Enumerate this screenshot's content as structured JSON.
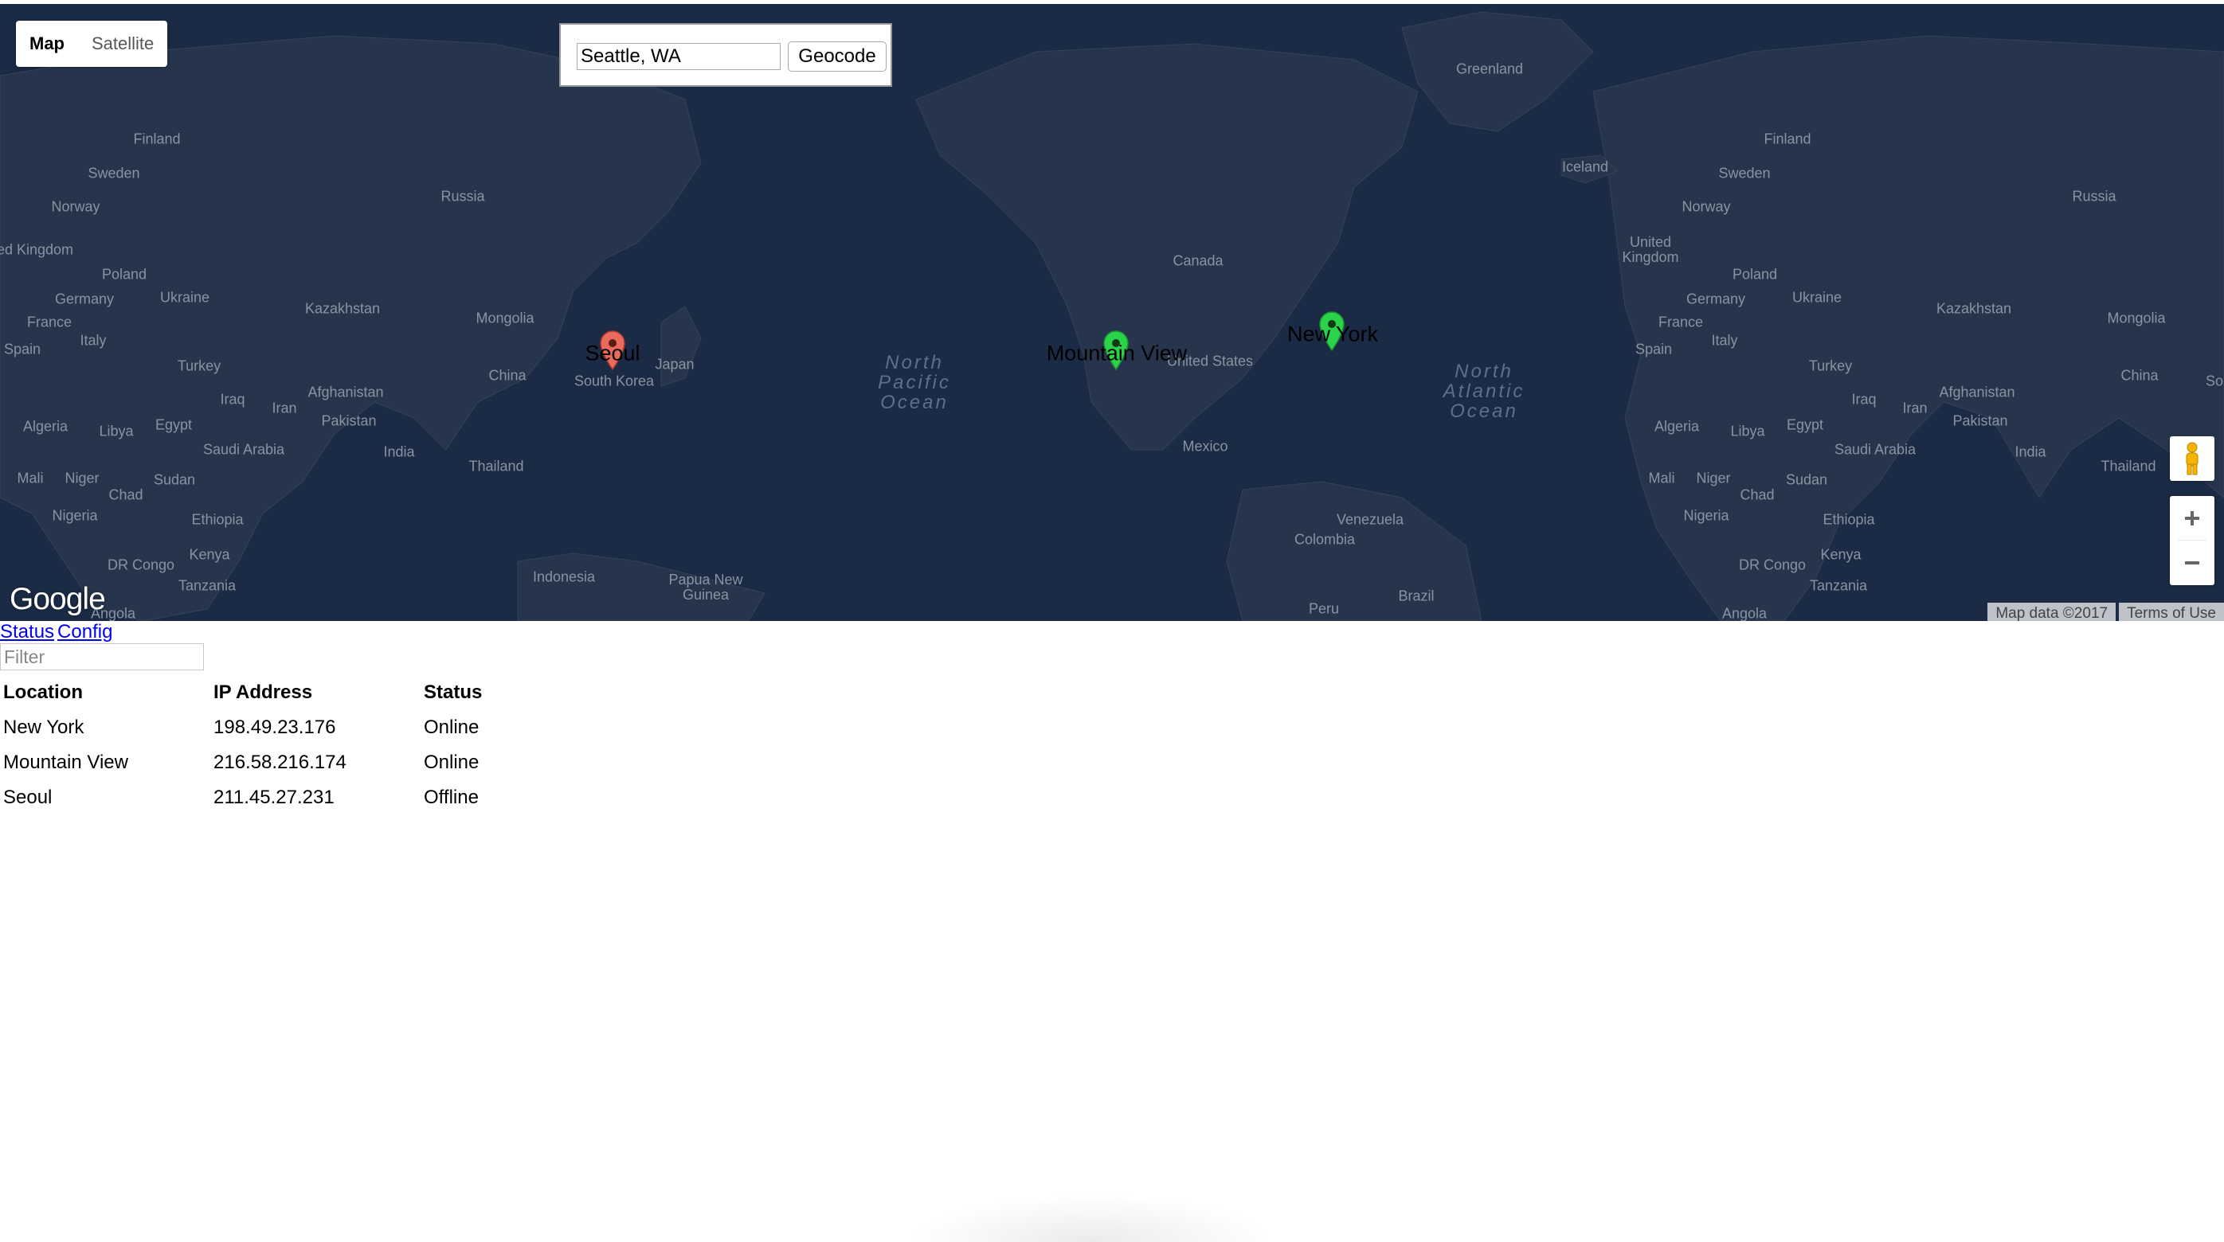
{
  "map": {
    "map_types": [
      "Map",
      "Satellite"
    ],
    "active_map_type": "Map",
    "geocode": {
      "address_value": "Seattle, WA",
      "button_label": "Geocode"
    },
    "google_logo": "Google",
    "attribution": [
      "Map data ©2017",
      "Terms of Use"
    ],
    "controls": {
      "pegman_icon": "pegman-icon",
      "zoom_in": "+",
      "zoom_out": "−"
    },
    "colors": {
      "water": "#1b2a45",
      "land": "#27354c",
      "marker_offline": "#ea6a5e",
      "marker_online": "#2bd34b"
    },
    "markers": [
      {
        "name": "Seoul",
        "status": "Offline"
      },
      {
        "name": "Mountain View",
        "status": "Online"
      },
      {
        "name": "New York",
        "status": "Online"
      }
    ],
    "labels": {
      "greenland": "Greenland",
      "iceland": "Iceland",
      "finland_l": "Finland",
      "sweden_l": "Sweden",
      "norway_l": "Norway",
      "uk_l": "United Kingdom",
      "poland_l": "Poland",
      "germany_l": "Germany",
      "ukraine_l": "Ukraine",
      "france_l": "France",
      "italy_l": "Italy",
      "spain_l": "Spain",
      "turkey_l": "Turkey",
      "iraq_l": "Iraq",
      "iran_l": "Iran",
      "afghanistan_l": "Afghanistan",
      "pakistan_l": "Pakistan",
      "kazakhstan_l": "Kazakhstan",
      "russia_l": "Russia",
      "mongolia_l": "Mongolia",
      "china_l": "China",
      "india_l": "India",
      "thailand_l": "Thailand",
      "saudi_l": "Saudi Arabia",
      "egypt_l": "Egypt",
      "libya_l": "Libya",
      "algeria_l": "Algeria",
      "mali_l": "Mali",
      "niger_l": "Niger",
      "chad_l": "Chad",
      "sudan_l": "Sudan",
      "nigeria_l": "Nigeria",
      "ethiopia_l": "Ethiopia",
      "drc_l": "DR Congo",
      "kenya_l": "Kenya",
      "tanzania_l": "Tanzania",
      "angola_l": "Angola",
      "japan": "Japan",
      "south_korea": "South Korea",
      "indonesia": "Indonesia",
      "png": "Papua New Guinea",
      "canada": "Canada",
      "united_states": "United States",
      "mexico": "Mexico",
      "venezuela": "Venezuela",
      "colombia": "Colombia",
      "peru": "Peru",
      "brazil": "Brazil",
      "finland_r": "Finland",
      "sweden_r": "Sweden",
      "norway_r": "Norway",
      "uk_r": "United Kingdom",
      "poland_r": "Poland",
      "germany_r": "Germany",
      "ukraine_r": "Ukraine",
      "france_r": "France",
      "italy_r": "Italy",
      "spain_r": "Spain",
      "turkey_r": "Turkey",
      "iraq_r": "Iraq",
      "iran_r": "Iran",
      "afghanistan_r": "Afghanistan",
      "pakistan_r": "Pakistan",
      "kazakhstan_r": "Kazakhstan",
      "russia_r": "Russia",
      "mongolia_r": "Mongolia",
      "china_r": "China",
      "india_r": "India",
      "thailand_r": "Thailand",
      "saudi_r": "Saudi Arabia",
      "egypt_r": "Egypt",
      "libya_r": "Libya",
      "algeria_r": "Algeria",
      "mali_r": "Mali",
      "niger_r": "Niger",
      "chad_r": "Chad",
      "sudan_r": "Sudan",
      "nigeria_r": "Nigeria",
      "ethiopia_r": "Ethiopia",
      "drc_r": "DR Congo",
      "kenya_r": "Kenya",
      "tanzania_r": "Tanzania",
      "angola_r": "Angola",
      "somalia_r": "So",
      "north_pacific": "North Pacific Ocean",
      "north_atlantic": "North Atlantic Ocean"
    }
  },
  "nav": {
    "status_link": "Status",
    "config_link": "Config"
  },
  "filter": {
    "placeholder": "Filter",
    "value": ""
  },
  "table": {
    "headers": [
      "Location",
      "IP Address",
      "Status"
    ],
    "rows": [
      [
        "New York",
        "198.49.23.176",
        "Online"
      ],
      [
        "Mountain View",
        "216.58.216.174",
        "Online"
      ],
      [
        "Seoul",
        "211.45.27.231",
        "Offline"
      ]
    ]
  }
}
